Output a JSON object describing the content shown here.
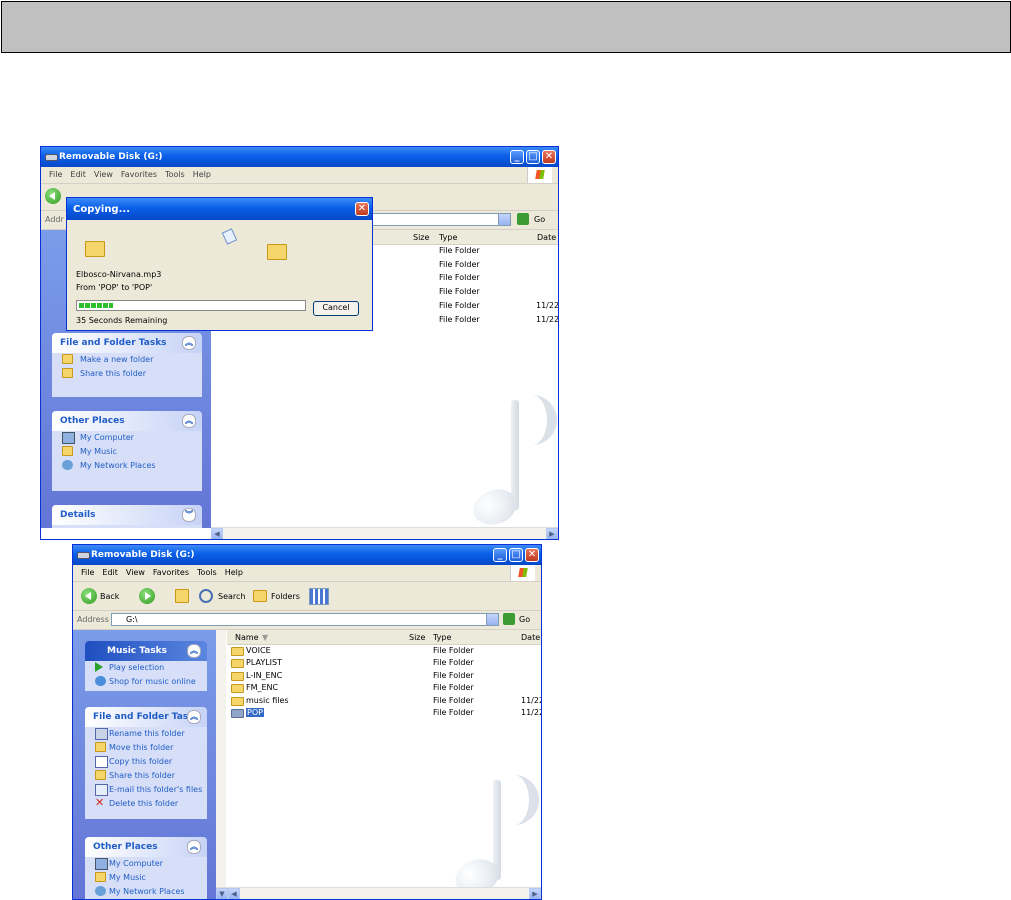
{
  "top_window": {
    "title": "Removable Disk (G:)",
    "menu": [
      "File",
      "Edit",
      "View",
      "Favorites",
      "Tools",
      "Help"
    ],
    "address_label": "Addr",
    "go_label": "Go",
    "columns": {
      "size": "Size",
      "type": "Type",
      "date": "Date"
    },
    "rows": [
      {
        "type": "File Folder",
        "date": ""
      },
      {
        "type": "File Folder",
        "date": ""
      },
      {
        "type": "File Folder",
        "date": ""
      },
      {
        "type": "File Folder",
        "date": ""
      },
      {
        "type": "File Folder",
        "date": "11/22,"
      },
      {
        "type": "File Folder",
        "date": "11/22,"
      }
    ],
    "file_folder_tasks": {
      "title": "File and Folder Tasks",
      "items": [
        "Make a new folder",
        "Share this folder"
      ]
    },
    "other_places": {
      "title": "Other Places",
      "items": [
        "My Computer",
        "My Music",
        "My Network Places"
      ]
    },
    "details": {
      "title": "Details"
    }
  },
  "copy_dialog": {
    "title": "Copying...",
    "filename": "Elbosco-Nirvana.mp3",
    "from_to": "From 'POP' to 'POP'",
    "remaining": "35 Seconds Remaining",
    "progress": 0.15,
    "cancel_label": "Cancel"
  },
  "bottom_window": {
    "title": "Removable Disk (G:)",
    "menu": [
      "File",
      "Edit",
      "View",
      "Favorites",
      "Tools",
      "Help"
    ],
    "toolbar": {
      "back": "Back",
      "search": "Search",
      "folders": "Folders"
    },
    "address_label": "Address",
    "address_value": "G:\\",
    "go_label": "Go",
    "columns": {
      "name": "Name",
      "size": "Size",
      "type": "Type",
      "date": "Date"
    },
    "rows": [
      {
        "name": "VOICE",
        "type": "File Folder",
        "date": ""
      },
      {
        "name": "PLAYLIST",
        "type": "File Folder",
        "date": ""
      },
      {
        "name": "L-IN_ENC",
        "type": "File Folder",
        "date": ""
      },
      {
        "name": "FM_ENC",
        "type": "File Folder",
        "date": ""
      },
      {
        "name": "music files",
        "type": "File Folder",
        "date": "11/22,"
      },
      {
        "name": "POP",
        "type": "File Folder",
        "date": "11/22,"
      }
    ],
    "music_tasks": {
      "title": "Music Tasks",
      "items": [
        "Play selection",
        "Shop for music online"
      ]
    },
    "file_folder_tasks": {
      "title": "File and Folder Tasks",
      "items": [
        "Rename this folder",
        "Move this folder",
        "Copy this folder",
        "Share this folder",
        "E-mail this folder's files",
        "Delete this folder"
      ]
    },
    "other_places": {
      "title": "Other Places",
      "items": [
        "My Computer",
        "My Music",
        "My Network Places"
      ]
    }
  }
}
